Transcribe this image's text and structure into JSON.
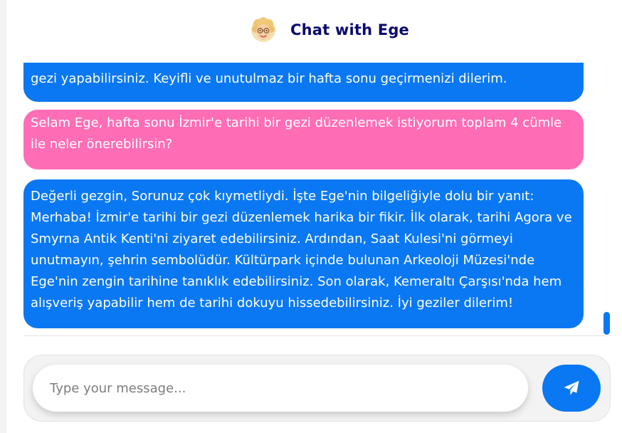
{
  "header": {
    "title": "Chat with Ege",
    "avatar_icon": "memoji-avatar-icon"
  },
  "messages": [
    {
      "role": "bot",
      "text": "gezi yapabilirsiniz. Keyifli ve unutulmaz bir hafta sonu geçirmenizi dilerim."
    },
    {
      "role": "user",
      "text": "Selam Ege, hafta sonu İzmir'e tarihi bir gezi düzenlemek istiyorum toplam 4 cümle ile neler önerebilirsin?"
    },
    {
      "role": "bot",
      "text": "Değerli gezgin, Sorunuz çok kıymetliydi. İşte Ege'nin bilgeliğiyle dolu bir yanıt: Merhaba! İzmir'e tarihi bir gezi düzenlemek harika bir fikir. İlk olarak, tarihi Agora ve Smyrna Antik Kenti'ni ziyaret edebilirsiniz. Ardından, Saat Kulesi'ni görmeyi unutmayın, şehrin sembolüdür. Kültürpark içinde bulunan Arkeoloji Müzesi'nde Ege'nin zengin tarihine tanıklık edebilirsiniz. Son olarak, Kemeraltı Çarşısı'nda hem alışveriş yapabilir hem de tarihi dokuyu hissedebilirsiniz. İyi geziler dilerim!"
    }
  ],
  "composer": {
    "value": "",
    "placeholder": "Type your message...",
    "send_icon": "paper-plane-icon"
  },
  "colors": {
    "bot_bubble": "#0a78f2",
    "user_bubble": "#ff6db6",
    "title": "#0b0b6e",
    "accent": "#0a78f2"
  }
}
